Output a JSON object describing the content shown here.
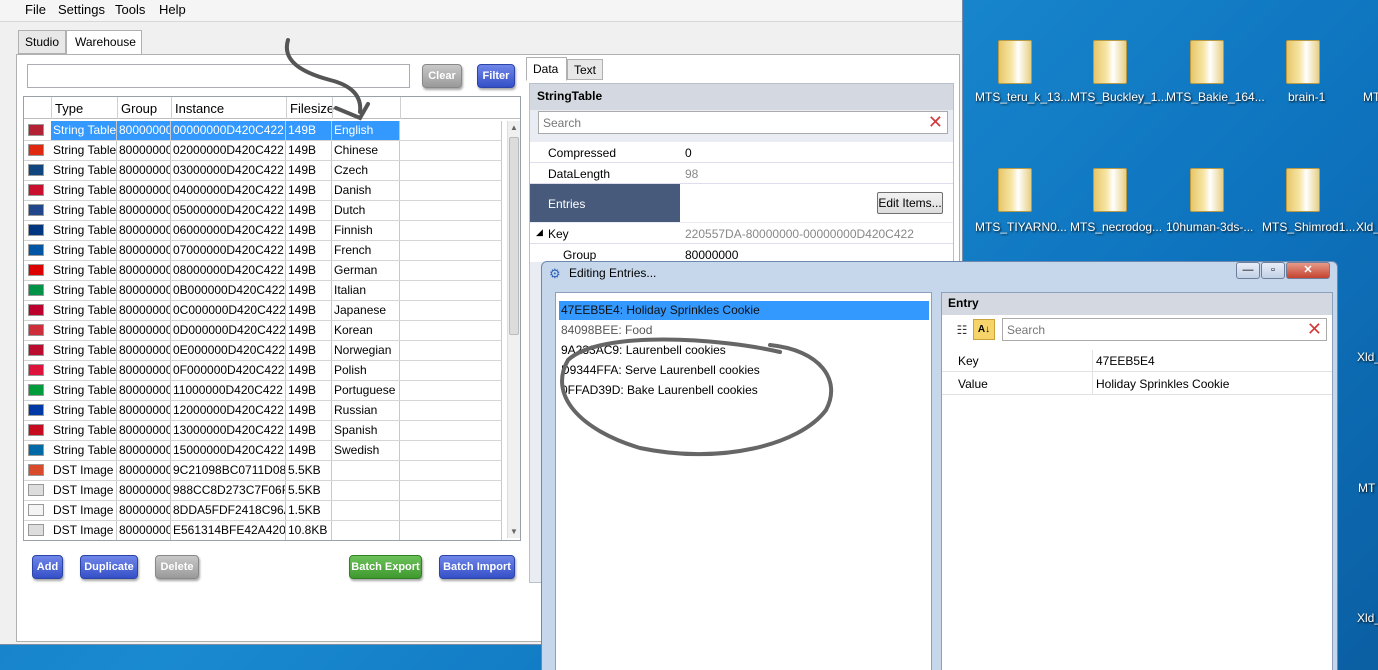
{
  "menu": [
    "File",
    "Settings",
    "Tools",
    "Help"
  ],
  "tabs": [
    "Studio",
    "Warehouse"
  ],
  "toolbar": {
    "clear": "Clear",
    "filter": "Filter"
  },
  "grid": {
    "headers": [
      "Type",
      "Group",
      "Instance",
      "Filesize"
    ],
    "rows": [
      {
        "type": "String Table",
        "group": "80000000",
        "instance": "00000000D420C422",
        "size": "149B",
        "lang": "English",
        "flag": "#b22234"
      },
      {
        "type": "String Table",
        "group": "80000000",
        "instance": "02000000D420C422",
        "size": "149B",
        "lang": "Chinese",
        "flag": "#de2910"
      },
      {
        "type": "String Table",
        "group": "80000000",
        "instance": "03000000D420C422",
        "size": "149B",
        "lang": "Czech",
        "flag": "#11457e"
      },
      {
        "type": "String Table",
        "group": "80000000",
        "instance": "04000000D420C422",
        "size": "149B",
        "lang": "Danish",
        "flag": "#c8102e"
      },
      {
        "type": "String Table",
        "group": "80000000",
        "instance": "05000000D420C422",
        "size": "149B",
        "lang": "Dutch",
        "flag": "#21468b"
      },
      {
        "type": "String Table",
        "group": "80000000",
        "instance": "06000000D420C422",
        "size": "149B",
        "lang": "Finnish",
        "flag": "#003580"
      },
      {
        "type": "String Table",
        "group": "80000000",
        "instance": "07000000D420C422",
        "size": "149B",
        "lang": "French",
        "flag": "#0055a4"
      },
      {
        "type": "String Table",
        "group": "80000000",
        "instance": "08000000D420C422",
        "size": "149B",
        "lang": "German",
        "flag": "#dd0000"
      },
      {
        "type": "String Table",
        "group": "80000000",
        "instance": "0B000000D420C422",
        "size": "149B",
        "lang": "Italian",
        "flag": "#009246"
      },
      {
        "type": "String Table",
        "group": "80000000",
        "instance": "0C000000D420C422",
        "size": "149B",
        "lang": "Japanese",
        "flag": "#bc002d"
      },
      {
        "type": "String Table",
        "group": "80000000",
        "instance": "0D000000D420C422",
        "size": "149B",
        "lang": "Korean",
        "flag": "#cd2e3a"
      },
      {
        "type": "String Table",
        "group": "80000000",
        "instance": "0E000000D420C422",
        "size": "149B",
        "lang": "Norwegian",
        "flag": "#ba0c2f"
      },
      {
        "type": "String Table",
        "group": "80000000",
        "instance": "0F000000D420C422",
        "size": "149B",
        "lang": "Polish",
        "flag": "#dc143c"
      },
      {
        "type": "String Table",
        "group": "80000000",
        "instance": "11000000D420C422",
        "size": "149B",
        "lang": "Portuguese",
        "flag": "#009c3b"
      },
      {
        "type": "String Table",
        "group": "80000000",
        "instance": "12000000D420C422",
        "size": "149B",
        "lang": "Russian",
        "flag": "#0039a6"
      },
      {
        "type": "String Table",
        "group": "80000000",
        "instance": "13000000D420C422",
        "size": "149B",
        "lang": "Spanish",
        "flag": "#c60b1e"
      },
      {
        "type": "String Table",
        "group": "80000000",
        "instance": "15000000D420C422",
        "size": "149B",
        "lang": "Swedish",
        "flag": "#006aa7"
      },
      {
        "type": "DST Image",
        "group": "80000000",
        "instance": "9C21098BC0711D08",
        "size": "5.5KB",
        "lang": "",
        "flag": "#d94a2a"
      },
      {
        "type": "DST Image",
        "group": "80000000",
        "instance": "988CC8D273C7F06F",
        "size": "5.5KB",
        "lang": "",
        "flag": "#dddddd"
      },
      {
        "type": "DST Image",
        "group": "80000000",
        "instance": "8DDA5FDF2418C96A",
        "size": "1.5KB",
        "lang": "",
        "flag": "#f4f4f4"
      },
      {
        "type": "DST Image",
        "group": "80000000",
        "instance": "E561314BFE42A420",
        "size": "10.8KB",
        "lang": "",
        "flag": "#dddddd"
      }
    ]
  },
  "bottom": {
    "add": "Add",
    "duplicate": "Duplicate",
    "delete": "Delete",
    "batch_export": "Batch Export",
    "batch_import": "Batch Import"
  },
  "right_tabs": [
    "Data",
    "Text"
  ],
  "props": {
    "header": "StringTable",
    "search_placeholder": "Search",
    "compressed_label": "Compressed",
    "compressed": "0",
    "datalength_label": "DataLength",
    "datalength": "98",
    "entries_label": "Entries",
    "edit_items": "Edit Items...",
    "key_label": "Key",
    "key": "220557DA-80000000-00000000D420C422",
    "group_label": "Group",
    "group": "80000000"
  },
  "dialog": {
    "title": "Editing Entries...",
    "items": [
      "47EEB5E4: Holiday Sprinkles Cookie",
      "84098BEE: Food",
      "9A233AC9: Laurenbell cookies",
      "D9344FFA: Serve Laurenbell cookies",
      "0FFAD39D: Bake Laurenbell cookies"
    ],
    "entry_header": "Entry",
    "search_placeholder": "Search",
    "key_label": "Key",
    "key": "47EEB5E4",
    "value_label": "Value",
    "value": "Holiday Sprinkles Cookie"
  },
  "desktop": {
    "row1": [
      "MTS_teru_k_13...",
      "MTS_Buckley_1...",
      "MTS_Bakie_164...",
      "brain-1",
      "MT"
    ],
    "row2": [
      "MTS_TIYARN0...",
      "MTS_necrodog...",
      "10human-3ds-...",
      "MTS_Shimrod1...",
      "Xld_"
    ],
    "edge": [
      "Xld_",
      "MT",
      "Xld_"
    ]
  }
}
